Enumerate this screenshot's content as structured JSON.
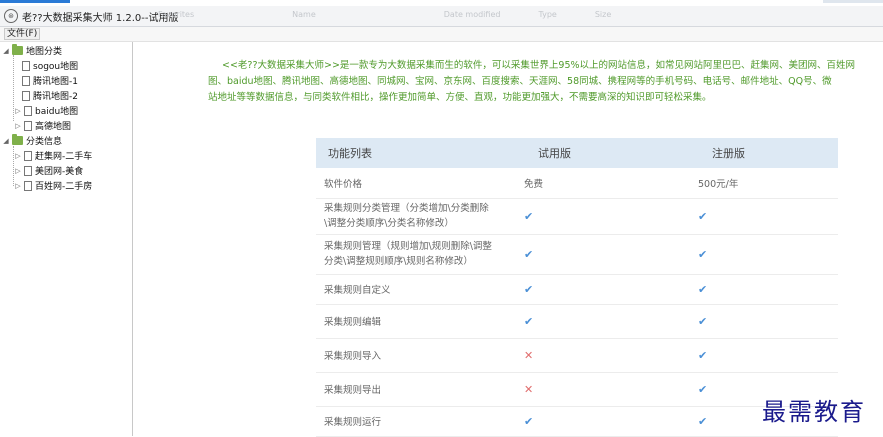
{
  "window": {
    "title": "老??大数据采集大师 1.2.0--试用版",
    "ghost_tabs": [
      "Favorites",
      "Name",
      "Date modified",
      "Type",
      "Size"
    ]
  },
  "menu": {
    "file_label": "文件(F)"
  },
  "tree": [
    {
      "label": "地图分类",
      "level": 0,
      "kind": "folder",
      "expanded": true
    },
    {
      "label": "sogou地图",
      "level": 1,
      "kind": "doc"
    },
    {
      "label": "腾讯地图-1",
      "level": 1,
      "kind": "doc"
    },
    {
      "label": "腾讯地图-2",
      "level": 1,
      "kind": "doc"
    },
    {
      "label": "baidu地图",
      "level": 1,
      "kind": "doc",
      "collapsed": true
    },
    {
      "label": "高德地图",
      "level": 1,
      "kind": "doc",
      "collapsed": true
    },
    {
      "label": "分类信息",
      "level": 0,
      "kind": "folder",
      "expanded": true
    },
    {
      "label": "赶集网-二手车",
      "level": 1,
      "kind": "doc",
      "collapsed": true
    },
    {
      "label": "美团网-美食",
      "level": 1,
      "kind": "doc",
      "collapsed": true
    },
    {
      "label": "百姓网-二手房",
      "level": 1,
      "kind": "doc",
      "collapsed": true
    }
  ],
  "intro": {
    "line1": "<<老??大数据采集大师>>是一款专为大数据采集而生的软件，可以采集世界上95%以上的网站信息，如常见网站阿里巴巴、赶集网、美团网、百姓网",
    "line2": "图、baidu地图、腾讯地图、高德地图、同城网、宝网、京东网、百度搜索、天涯网、58同城、携程网等的手机号码、电话号、邮件地址、QQ号、微",
    "line3": "站地址等等数据信息，与同类软件相比，操作更加简单、方便、直观，功能更加强大，不需要高深的知识即可轻松采集。"
  },
  "table": {
    "headers": [
      "功能列表",
      "试用版",
      "注册版"
    ],
    "rows": [
      {
        "feature": "软件价格",
        "trial": "免费",
        "registered": "500元/年"
      },
      {
        "feature_line1": "采集规则分类管理（分类增加\\分类删除",
        "feature_line2": "\\调整分类顺序\\分类名称修改）",
        "trial": "check",
        "registered": "check"
      },
      {
        "feature_line1": "采集规则管理（规则增加\\规则删除\\调整",
        "feature_line2": "分类\\调整规则顺序\\规则名称修改）",
        "trial": "check",
        "registered": "check"
      },
      {
        "feature": "采集规则自定义",
        "trial": "check",
        "registered": "check"
      },
      {
        "feature": "采集规则编辑",
        "trial": "check",
        "registered": "check"
      },
      {
        "feature": "采集规则导入",
        "trial": "cross",
        "registered": "check"
      },
      {
        "feature": "采集规则导出",
        "trial": "cross",
        "registered": "check"
      },
      {
        "feature": "采集规则运行",
        "trial": "check",
        "registered": "check"
      }
    ]
  },
  "watermark": "最需教育",
  "colors": {
    "intro_text": "#4f9a2a",
    "header_bg": "#dde9f4",
    "check": "#4a8fd6",
    "cross": "#e06c6c",
    "watermark": "#1a1a8c"
  }
}
